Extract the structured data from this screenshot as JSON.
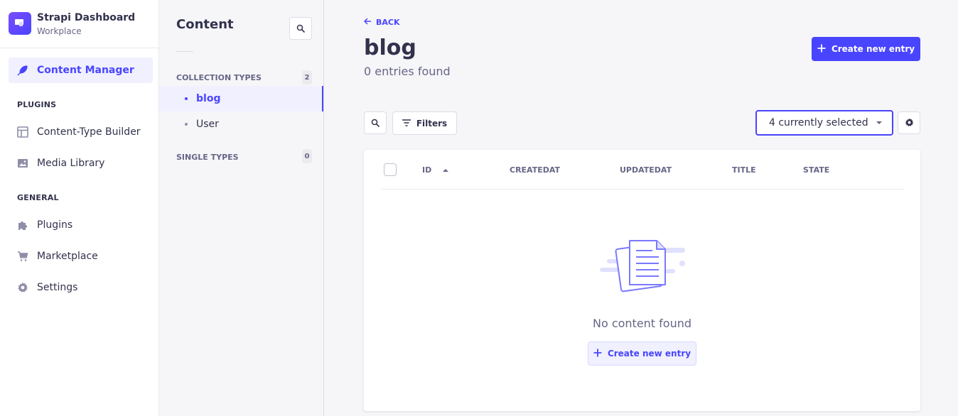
{
  "brand": {
    "title": "Strapi Dashboard",
    "subtitle": "Workplace"
  },
  "main_nav": {
    "content_manager": {
      "label": "Content Manager",
      "icon": "feather-icon"
    },
    "plugins_section": "PLUGINS",
    "plugins": [
      {
        "label": "Content-Type Builder",
        "icon": "layout-icon"
      },
      {
        "label": "Media Library",
        "icon": "image-icon"
      }
    ],
    "general_section": "GENERAL",
    "general": [
      {
        "label": "Plugins",
        "icon": "puzzle-icon"
      },
      {
        "label": "Marketplace",
        "icon": "cart-icon"
      },
      {
        "label": "Settings",
        "icon": "gear-icon"
      }
    ]
  },
  "sub_nav": {
    "title": "Content",
    "collection_types": {
      "label": "COLLECTION TYPES",
      "count": "2",
      "items": [
        "blog",
        "User"
      ]
    },
    "single_types": {
      "label": "SINGLE TYPES",
      "count": "0"
    }
  },
  "header": {
    "back_label": "BACK",
    "title": "blog",
    "subtitle": "0 entries found",
    "create_label": "Create new entry"
  },
  "toolbar": {
    "filters_label": "Filters",
    "columns_select": "4 currently selected"
  },
  "table": {
    "columns": [
      "ID",
      "CREATEDAT",
      "UPDATEDAT",
      "TITLE",
      "STATE"
    ],
    "empty_text": "No content found",
    "empty_create_label": "Create new entry"
  },
  "colors": {
    "accent": "#4945ff",
    "accent_light": "#f0f0ff",
    "text": "#32324d",
    "muted": "#666687"
  }
}
